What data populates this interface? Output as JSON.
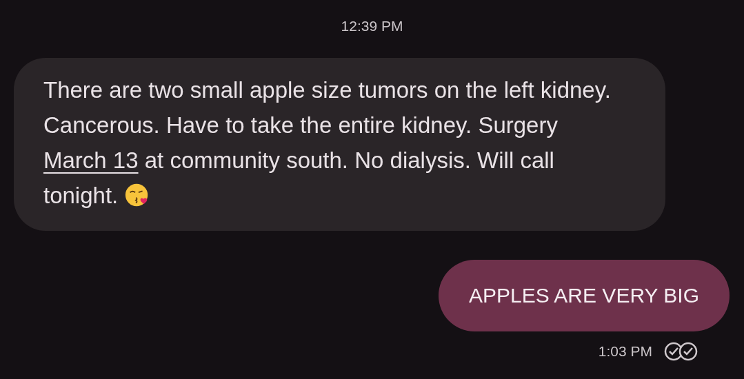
{
  "messages": [
    {
      "kind": "timestamp",
      "text": "12:39 PM"
    },
    {
      "kind": "incoming",
      "parts": [
        {
          "kind": "text",
          "text": "There are two small apple size tumors on the left kidney. Cancerous. Have to take the entire kidney. Surgery "
        },
        {
          "kind": "link",
          "text": "March 13"
        },
        {
          "kind": "text",
          "text": " at community south. No dialysis. Will call tonight."
        }
      ],
      "emoji": true
    },
    {
      "kind": "outgoing",
      "text": "APPLES ARE VERY BIG",
      "time": "1:03 PM",
      "read": true
    }
  ]
}
